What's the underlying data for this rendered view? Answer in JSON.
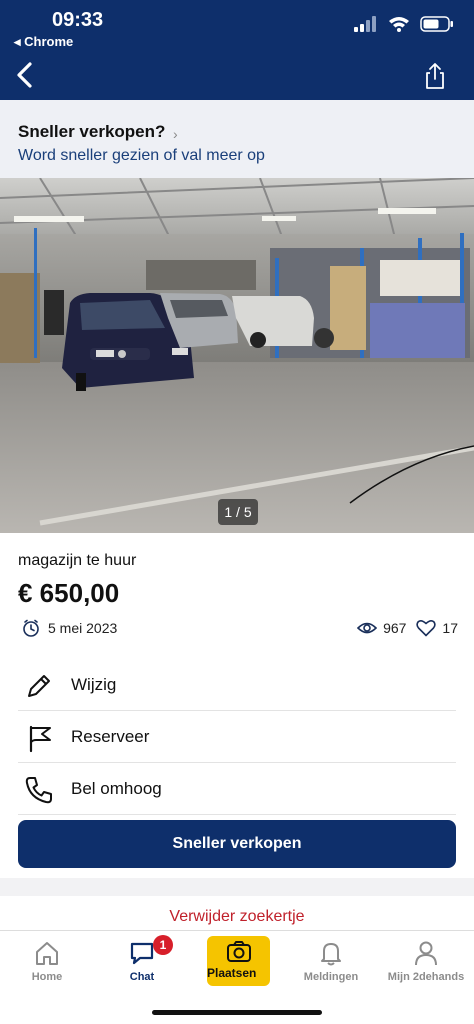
{
  "status_bar": {
    "time": "09:33",
    "back_app": "◂ Chrome",
    "icons": [
      "signal-icon",
      "wifi-icon",
      "battery-icon"
    ]
  },
  "nav": {
    "back_icon": "chevron-left-icon",
    "share_icon": "share-icon"
  },
  "promo": {
    "title": "Sneller verkopen?",
    "chevron": "›",
    "subtitle": "Word sneller gezien of val meer op"
  },
  "photo": {
    "counter": "1 / 5"
  },
  "ad": {
    "title": "magazijn te huur",
    "price": "€ 650,00",
    "date": "5 mei 2023",
    "views": "967",
    "favorites": "17"
  },
  "actions": [
    {
      "label": "Wijzig",
      "icon": "pencil-icon"
    },
    {
      "label": "Reserveer",
      "icon": "flag-icon"
    },
    {
      "label": "Bel omhoog",
      "icon": "phone-icon"
    }
  ],
  "cta": {
    "label": "Sneller verkopen"
  },
  "delete": {
    "label": "Verwijder zoekertje"
  },
  "tabs": [
    {
      "label": "Home",
      "icon": "home-icon"
    },
    {
      "label": "Chat",
      "icon": "chat-icon",
      "badge": "1"
    },
    {
      "label": "Plaatsen",
      "icon": "camera-icon"
    },
    {
      "label": "Meldingen",
      "icon": "bell-icon"
    },
    {
      "label": "Mijn 2dehands",
      "icon": "user-icon"
    }
  ],
  "colors": {
    "brand": "#0e2f6b",
    "accent": "#f5c400",
    "danger": "#c0212b",
    "badge": "#d71f2a"
  }
}
